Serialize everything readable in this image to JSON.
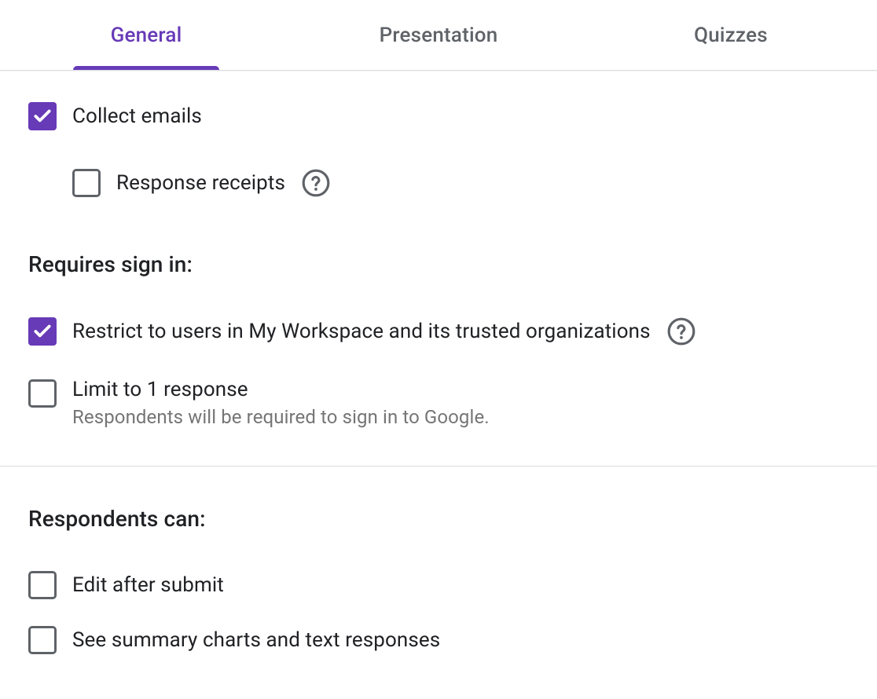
{
  "tabs": {
    "general": "General",
    "presentation": "Presentation",
    "quizzes": "Quizzes"
  },
  "options": {
    "collect_emails": "Collect emails",
    "response_receipts": "Response receipts",
    "restrict_users": "Restrict to users in My Workspace and its trusted organizations",
    "limit_one_response": "Limit to 1 response",
    "limit_one_response_sub": "Respondents will be required to sign in to Google.",
    "edit_after_submit": "Edit after submit",
    "see_summary": "See summary charts and text responses"
  },
  "headings": {
    "requires_sign_in": "Requires sign in:",
    "respondents_can": "Respondents can:"
  }
}
